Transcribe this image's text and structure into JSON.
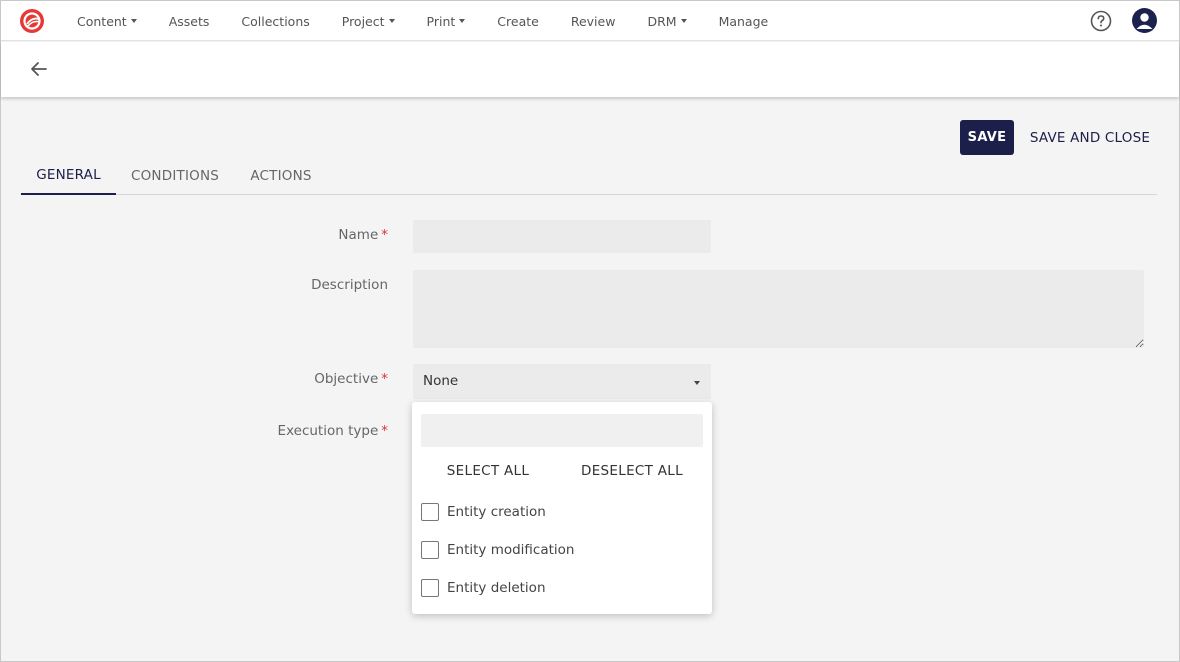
{
  "topnav": {
    "items": [
      {
        "label": "Content",
        "has_dropdown": true
      },
      {
        "label": "Assets",
        "has_dropdown": false
      },
      {
        "label": "Collections",
        "has_dropdown": false
      },
      {
        "label": "Project",
        "has_dropdown": true
      },
      {
        "label": "Print",
        "has_dropdown": true
      },
      {
        "label": "Create",
        "has_dropdown": false
      },
      {
        "label": "Review",
        "has_dropdown": false
      },
      {
        "label": "DRM",
        "has_dropdown": true
      },
      {
        "label": "Manage",
        "has_dropdown": false
      }
    ],
    "help_icon": "help-circle-icon",
    "avatar_icon": "user-avatar-icon",
    "logo_icon": "brand-logo-icon"
  },
  "colors": {
    "brand_red": "#e53935",
    "primary_navy": "#1c1f4a",
    "required_red": "#e03131",
    "page_bg": "#f4f4f4",
    "input_bg": "#ebebeb"
  },
  "actions": {
    "save_label": "SAVE",
    "save_close_label": "SAVE AND CLOSE"
  },
  "tabs": [
    {
      "label": "GENERAL",
      "active": true
    },
    {
      "label": "CONDITIONS",
      "active": false
    },
    {
      "label": "ACTIONS",
      "active": false
    }
  ],
  "form": {
    "name": {
      "label": "Name",
      "required": "*",
      "value": ""
    },
    "description": {
      "label": "Description",
      "value": ""
    },
    "objective": {
      "label": "Objective",
      "required": "*",
      "value": "None"
    },
    "execution_type": {
      "label": "Execution type",
      "required": "*"
    }
  },
  "dropdown": {
    "search_value": "",
    "select_all_label": "SELECT ALL",
    "deselect_all_label": "DESELECT ALL",
    "options": [
      {
        "label": "Entity creation",
        "checked": false
      },
      {
        "label": "Entity modification",
        "checked": false
      },
      {
        "label": "Entity deletion",
        "checked": false
      }
    ]
  }
}
